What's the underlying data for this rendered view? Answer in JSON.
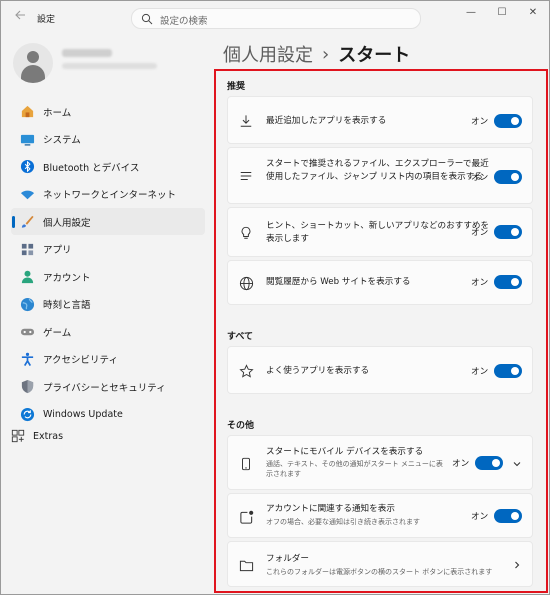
{
  "window": {
    "app_title": "設定",
    "search_placeholder": "設定の検索",
    "controls": {
      "minimize": "—",
      "maximize": "☐",
      "close": "✕"
    }
  },
  "sidebar": {
    "items": [
      {
        "label": "ホーム",
        "icon": "home-icon",
        "color": "#e8a33c"
      },
      {
        "label": "システム",
        "icon": "system-icon",
        "color": "#2a8fd6"
      },
      {
        "label": "Bluetooth とデバイス",
        "icon": "bluetooth-icon",
        "color": "#0a6fd6"
      },
      {
        "label": "ネットワークとインターネット",
        "icon": "wifi-icon",
        "color": "#2b8ad8"
      },
      {
        "label": "個人用設定",
        "icon": "personalization-icon",
        "color": "#d4883a",
        "active": true
      },
      {
        "label": "アプリ",
        "icon": "apps-icon",
        "color": "#5c6d88"
      },
      {
        "label": "アカウント",
        "icon": "account-icon",
        "color": "#2aa57e"
      },
      {
        "label": "時刻と言語",
        "icon": "time-language-icon",
        "color": "#2b86d0"
      },
      {
        "label": "ゲーム",
        "icon": "gaming-icon",
        "color": "#8a8a8a"
      },
      {
        "label": "アクセシビリティ",
        "icon": "accessibility-icon",
        "color": "#1b6fd6"
      },
      {
        "label": "プライバシーとセキュリティ",
        "icon": "shield-icon",
        "color": "#6d7480"
      },
      {
        "label": "Windows Update",
        "icon": "update-icon",
        "color": "#0e78d5"
      }
    ],
    "extras_label": "Extras"
  },
  "breadcrumb": {
    "parent": "個人用設定",
    "separator": "›",
    "current": "スタート"
  },
  "sections": {
    "recommended": "推奨",
    "all": "すべて",
    "other": "その他"
  },
  "settings": {
    "recent_apps": {
      "label": "最近追加したアプリを表示する",
      "state": "オン"
    },
    "recommended_files": {
      "label": "スタートで推奨されるファイル、エクスプローラーで最近使用したファイル、ジャンプ リスト内の項目を表示する",
      "line1": "スタートで推奨されるファイル、エクスプローラーで最近",
      "line2": "使用したファイル、ジャンプ リスト内の項目を表示する",
      "state": "オン"
    },
    "tips": {
      "line1": "ヒント、ショートカット、新しいアプリなどのおすすめを",
      "line2": "表示します",
      "state": "オン"
    },
    "web_history": {
      "label": "閲覧履歴から Web サイトを表示する",
      "state": "オン"
    },
    "most_used": {
      "label": "よく使うアプリを表示する",
      "state": "オン"
    },
    "mobile_device": {
      "label": "スタートにモバイル デバイスを表示する",
      "sub1": "通話、テキスト、その他の通知がスタート メニューに表",
      "sub2": "示されます",
      "state": "オン"
    },
    "account_notif": {
      "label": "アカウントに関連する通知を表示",
      "sub": "オフの場合、必要な通知は引き続き表示されます",
      "state": "オン"
    },
    "folders": {
      "label": "フォルダー",
      "sub": "これらのフォルダーは電源ボタンの横のスタート ボタンに表示されます"
    }
  },
  "colors": {
    "accent": "#0067c0",
    "highlight": "#e0141e"
  }
}
